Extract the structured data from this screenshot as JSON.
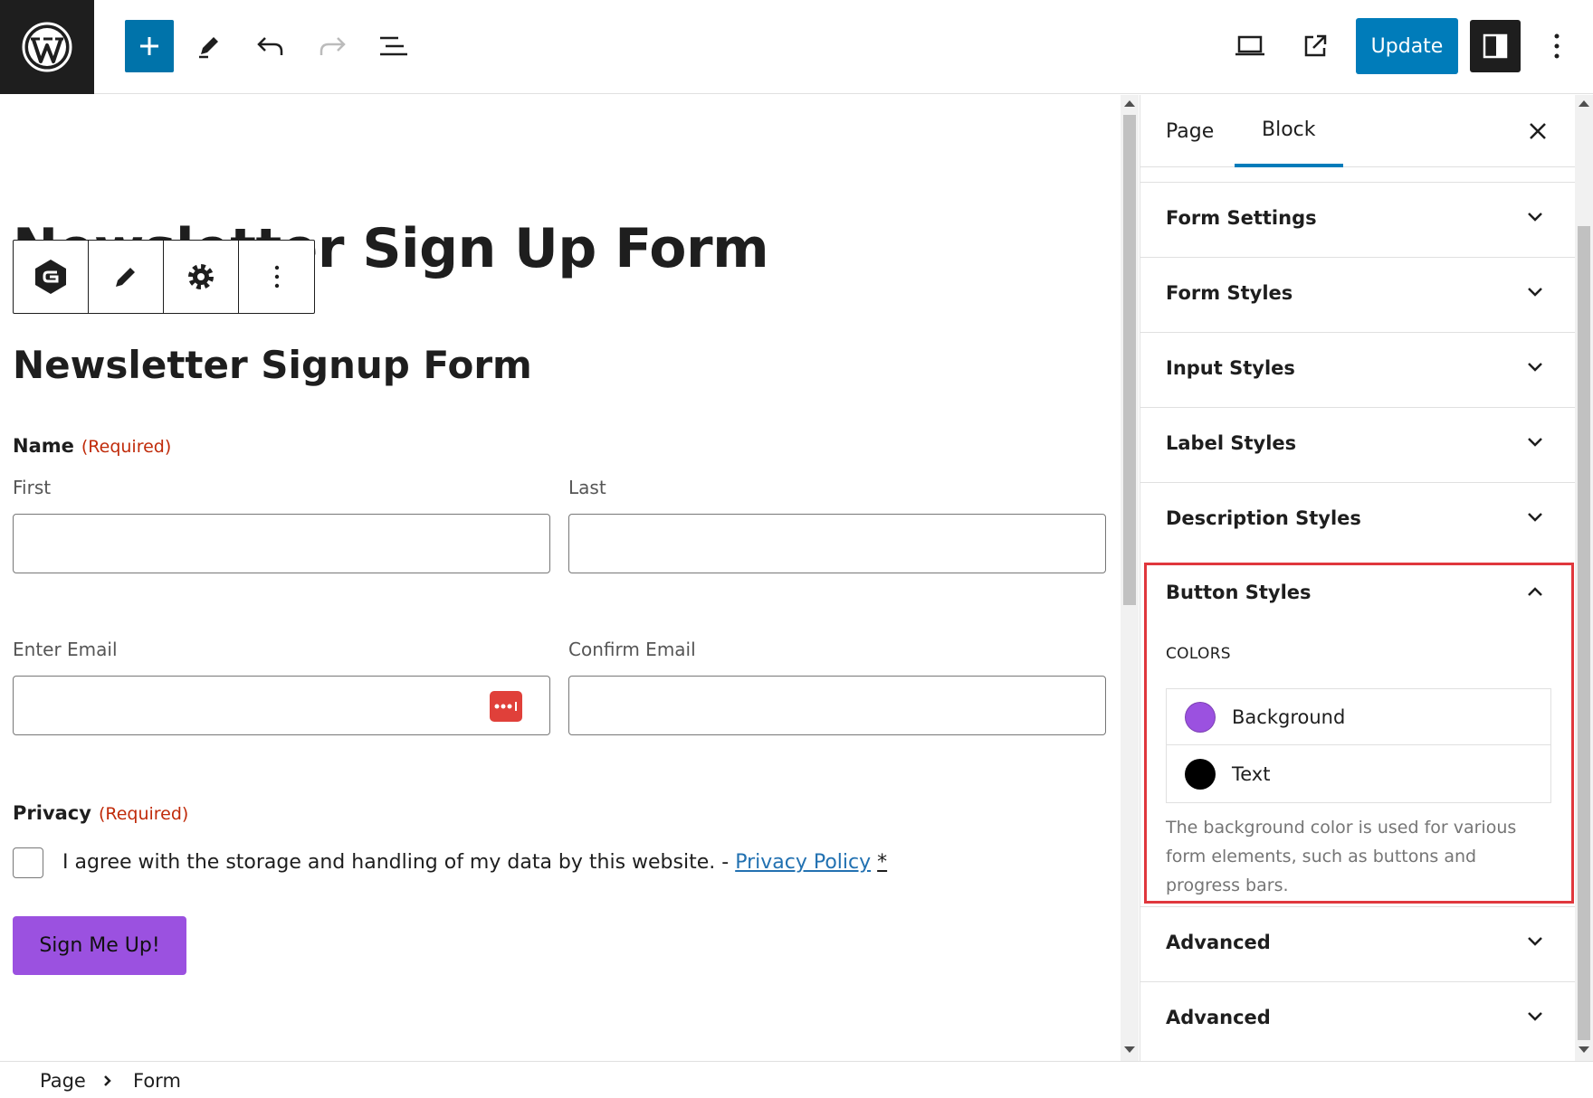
{
  "toolbar": {
    "update_label": "Update"
  },
  "canvas": {
    "page_title": "Newsletter Sign Up Form",
    "form_title": "Newsletter Signup Form",
    "name_label": "Name",
    "required": "(Required)",
    "first_label": "First",
    "last_label": "Last",
    "email_label": "Enter Email",
    "confirm_email_label": "Confirm Email",
    "privacy_label": "Privacy",
    "consent_text": "I agree with the storage and handling of my data by this website. - ",
    "privacy_link": "Privacy Policy",
    "asterisk": "*",
    "submit_label": "Sign Me Up!"
  },
  "sidebar": {
    "tabs": [
      {
        "label": "Page"
      },
      {
        "label": "Block"
      }
    ],
    "panels": [
      {
        "title": "Form Settings"
      },
      {
        "title": "Form Styles"
      },
      {
        "title": "Input Styles"
      },
      {
        "title": "Label Styles"
      },
      {
        "title": "Description Styles"
      },
      {
        "title": "Button Styles"
      },
      {
        "title": "Advanced"
      },
      {
        "title": "Advanced"
      }
    ],
    "colors_heading": "COLORS",
    "colors": [
      {
        "label": "Background",
        "value": "#9b51e0"
      },
      {
        "label": "Text",
        "value": "#000000"
      }
    ],
    "help_text": "The background color is used for various form elements, such as buttons and progress bars."
  },
  "breadcrumb": {
    "items": [
      "Page",
      "Form"
    ]
  }
}
